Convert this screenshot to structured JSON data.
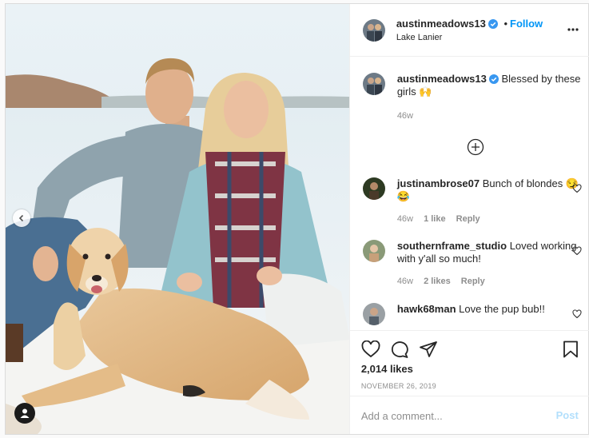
{
  "header": {
    "username": "austinmeadows13",
    "follow_label": "Follow",
    "location": "Lake Lanier"
  },
  "caption": {
    "username": "austinmeadows13",
    "text": "Blessed by these girls 🙌",
    "time": "46w"
  },
  "comments": [
    {
      "username": "justinambrose07",
      "text": "Bunch of blondes 😏😂",
      "time": "46w",
      "likes": "1 like",
      "reply": "Reply"
    },
    {
      "username": "southernframe_studio",
      "text": "Loved working with y'all so much!",
      "time": "46w",
      "likes": "2 likes",
      "reply": "Reply"
    },
    {
      "username": "hawk68man",
      "text": "Love the pup bub!!",
      "time": "",
      "likes": "",
      "reply": ""
    }
  ],
  "likes_count": "2,014 likes",
  "post_date": "NOVEMBER 26, 2019",
  "comment_box": {
    "placeholder": "Add a comment...",
    "post_label": "Post"
  },
  "colors": {
    "accent": "#0095f6",
    "post_disabled": "#b2dffc",
    "muted": "#8e8e8e"
  },
  "icons": [
    "verified-icon",
    "more-options-icon",
    "load-more-icon",
    "heart-icon",
    "comment-icon",
    "share-icon",
    "bookmark-icon",
    "chevron-left-icon",
    "user-tag-icon"
  ]
}
